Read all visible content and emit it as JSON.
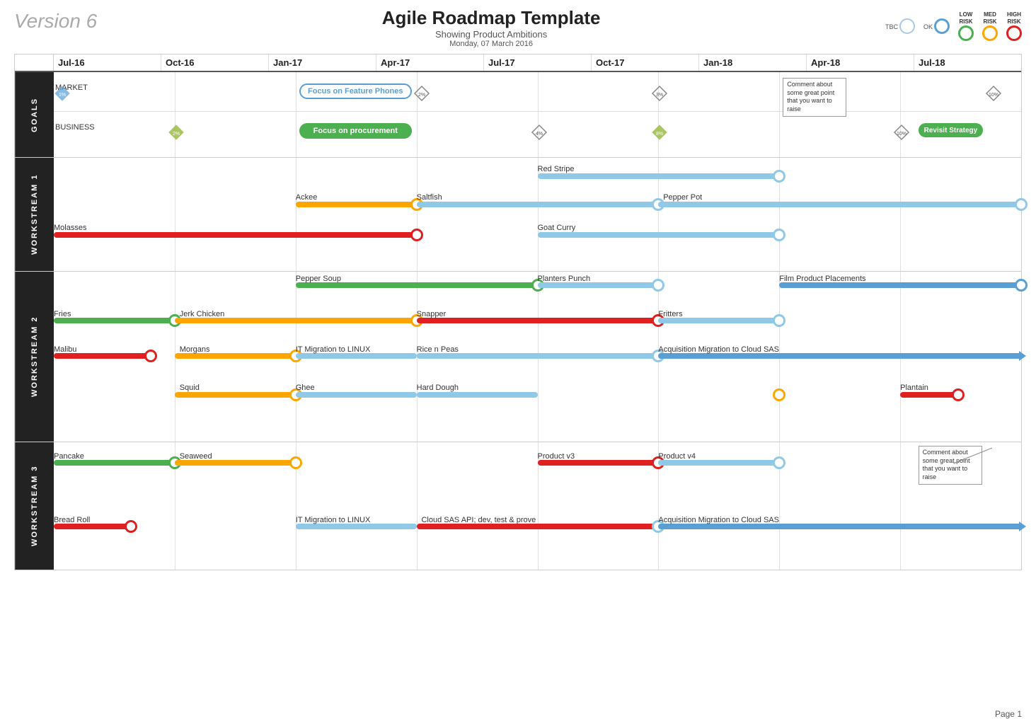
{
  "header": {
    "version": "Version 6",
    "title": "Agile Roadmap Template",
    "subtitle": "Showing Product Ambitions",
    "date": "Monday, 07 March 2016"
  },
  "legend": {
    "items": [
      {
        "label": "TBC",
        "class": "tbc"
      },
      {
        "label": "OK",
        "class": "ok"
      },
      {
        "label": "LOW\nRISK",
        "class": "low"
      },
      {
        "label": "MED\nRISK",
        "class": "med"
      },
      {
        "label": "HIGH\nRISK",
        "class": "high"
      }
    ]
  },
  "timeline": {
    "dates": [
      "Jul-16",
      "Oct-16",
      "Jan-17",
      "Apr-17",
      "Jul-17",
      "Oct-17",
      "Jan-18",
      "Apr-18",
      "Jul-18"
    ]
  },
  "sections": {
    "goals": "GOALS",
    "ws1": "WORKSTREAM 1",
    "ws2": "WORKSTREAM 2",
    "ws3": "WORKSTREAM 3"
  },
  "page_number": "Page 1"
}
